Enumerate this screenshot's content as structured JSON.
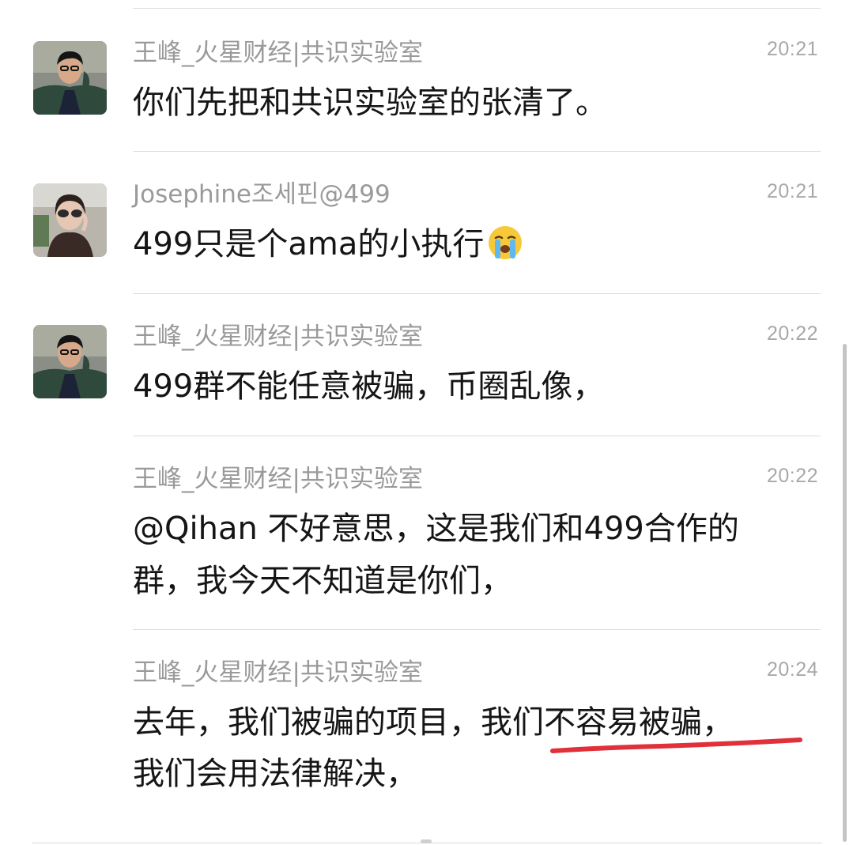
{
  "messages": [
    {
      "sender": "王峰_火星财经|共识实验室",
      "time": "20:21",
      "text": "你们先把和共识实验室的张清了。",
      "avatar": "avatar-wang-feng"
    },
    {
      "sender": "Josephine조세핀@499",
      "time": "20:21",
      "text": "499只是个ama的小执行",
      "emoji": "crying-face-icon",
      "avatar": "avatar-josephine"
    },
    {
      "sender": "王峰_火星财经|共识实验室",
      "time": "20:22",
      "text": "499群不能任意被骗，币圈乱像，",
      "avatar": "avatar-wang-feng"
    },
    {
      "sender": "王峰_火星财经|共识实验室",
      "time": "20:22",
      "lines": [
        "@Qihan 不好意思，这是我们和499合作的",
        "群，我今天不知道是你们，"
      ]
    },
    {
      "sender": "王峰_火星财经|共识实验室",
      "time": "20:24",
      "line1_prefix": "去年，我们被骗的项目，",
      "line1_emphasis": "我们不容易被骗",
      "line1_suffix": "，",
      "line2": "我们会用法律解决，"
    }
  ],
  "colors": {
    "sender": "#9a9a9a",
    "time": "#a8a8a8",
    "body": "#151515",
    "divider": "#dcdcdc",
    "annotation": "#e0303a"
  }
}
